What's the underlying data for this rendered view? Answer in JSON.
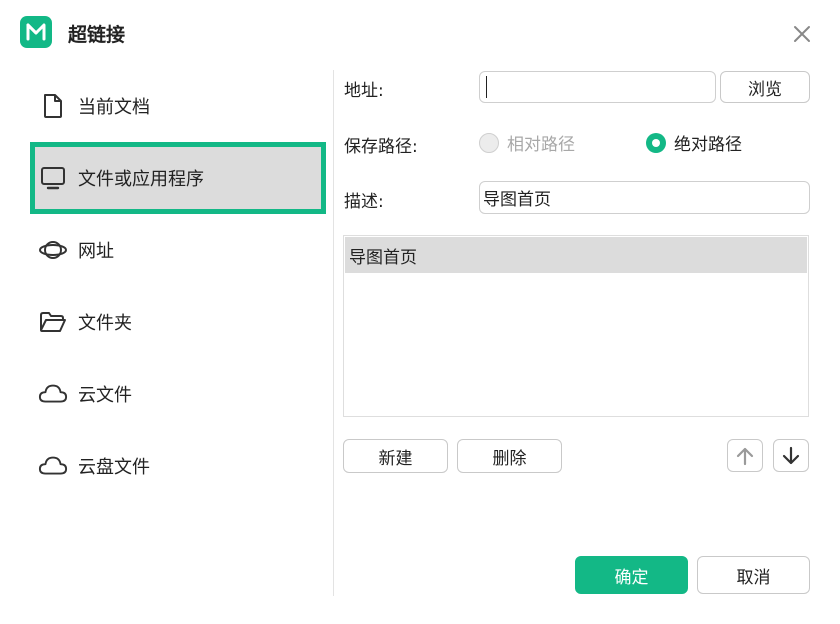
{
  "dialog": {
    "title": "超链接"
  },
  "sidebar": {
    "items": [
      {
        "label": "当前文档",
        "icon": "document-icon"
      },
      {
        "label": "文件或应用程序",
        "icon": "monitor-icon",
        "selected": true
      },
      {
        "label": "网址",
        "icon": "planet-icon"
      },
      {
        "label": "文件夹",
        "icon": "folder-icon"
      },
      {
        "label": "云文件",
        "icon": "cloud-icon"
      },
      {
        "label": "云盘文件",
        "icon": "cloud-drive-icon"
      }
    ]
  },
  "form": {
    "address_label": "地址:",
    "address_value": "",
    "browse_label": "浏览",
    "save_path_label": "保存路径:",
    "relative_path_label": "相对路径",
    "absolute_path_label": "绝对路径",
    "selected_path_mode": "绝对路径",
    "description_label": "描述:",
    "description_value": "导图首页"
  },
  "list": {
    "items": [
      "导图首页"
    ]
  },
  "actions": {
    "new_label": "新建",
    "delete_label": "删除",
    "confirm_label": "确定",
    "cancel_label": "取消"
  },
  "colors": {
    "accent": "#13b886",
    "selected_bg": "#dcdcdc"
  }
}
